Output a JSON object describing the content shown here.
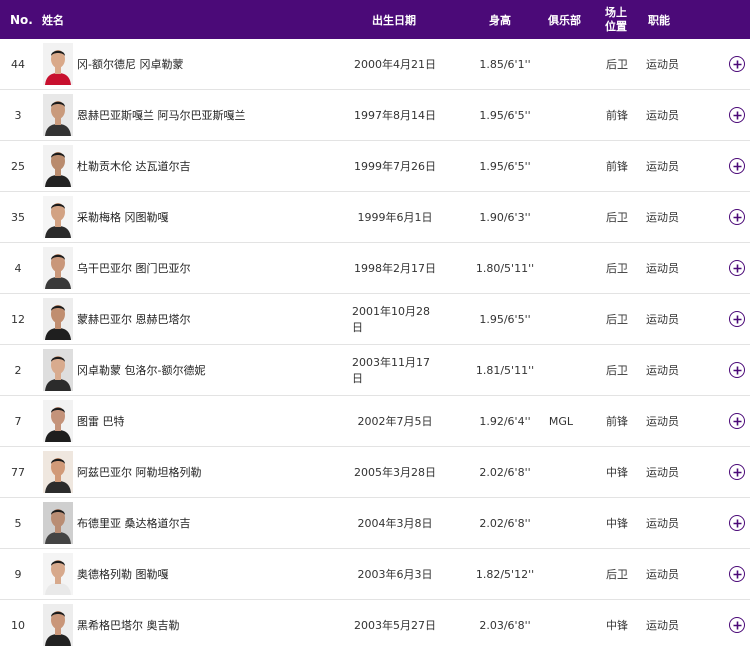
{
  "header": {
    "no": "No.",
    "name": "姓名",
    "dob": "出生日期",
    "height": "身高",
    "club": "俱乐部",
    "position": "场上位置",
    "role": "职能"
  },
  "colors": {
    "accent": "#4b0a78",
    "header_text": "#ffffff"
  },
  "icons": {
    "expand": "plus-circle-icon"
  },
  "players": [
    {
      "no": "44",
      "name": "冈-额尔德尼 冈卓勒蒙",
      "dob": "2000年4月21日",
      "height": "1.85/6'1''",
      "club": "",
      "position": "后卫",
      "role": "运动员",
      "shirt": "#c8102e",
      "skin": "#d9a98a",
      "bg": "#f2f2f2"
    },
    {
      "no": "3",
      "name": "恩赫巴亚斯嘎兰 阿马尔巴亚斯嘎兰",
      "dob": "1997年8月14日",
      "height": "1.95/6'5''",
      "club": "",
      "position": "前锋",
      "role": "运动员",
      "shirt": "#333333",
      "skin": "#c99a7c",
      "bg": "#e8e8e8"
    },
    {
      "no": "25",
      "name": "杜勒贡木伦 达瓦道尔吉",
      "dob": "1999年7月26日",
      "height": "1.95/6'5''",
      "club": "",
      "position": "前锋",
      "role": "运动员",
      "shirt": "#222222",
      "skin": "#b98b6d",
      "bg": "#f2f2f2"
    },
    {
      "no": "35",
      "name": "采勒梅格 冈图勒嘎",
      "dob": "1999年6月1日",
      "height": "1.90/6'3''",
      "club": "",
      "position": "后卫",
      "role": "运动员",
      "shirt": "#2a2a2a",
      "skin": "#d2a283",
      "bg": "#f5f5f5"
    },
    {
      "no": "4",
      "name": "乌干巴亚尔 图门巴亚尔",
      "dob": "1998年2月17日",
      "height": "1.80/5'11''",
      "club": "",
      "position": "后卫",
      "role": "运动员",
      "shirt": "#3a3a3a",
      "skin": "#c9977a",
      "bg": "#f2f2f2"
    },
    {
      "no": "12",
      "name": "蒙赫巴亚尔 恩赫巴塔尔",
      "dob": "2001年10月28日",
      "height": "1.95/6'5''",
      "club": "",
      "position": "后卫",
      "role": "运动员",
      "shirt": "#1f1f1f",
      "skin": "#c08e70",
      "bg": "#ededed"
    },
    {
      "no": "2",
      "name": "冈卓勒蒙 包洛尔-额尔德妮",
      "dob": "2003年11月17日",
      "height": "1.81/5'11''",
      "club": "",
      "position": "后卫",
      "role": "运动员",
      "shirt": "#2b2b2b",
      "skin": "#d8ab8e",
      "bg": "#dedede"
    },
    {
      "no": "7",
      "name": "图雷 巴特",
      "dob": "2002年7月5日",
      "height": "1.92/6'4''",
      "club": "MGL",
      "position": "前锋",
      "role": "运动员",
      "shirt": "#1e1e1e",
      "skin": "#c4937a",
      "bg": "#f2f2f2"
    },
    {
      "no": "77",
      "name": "阿兹巴亚尔 阿勒坦格列勒",
      "dob": "2005年3月28日",
      "height": "2.02/6'8''",
      "club": "",
      "position": "中锋",
      "role": "运动员",
      "shirt": "#2c2c2c",
      "skin": "#d19a78",
      "bg": "#efe7df"
    },
    {
      "no": "5",
      "name": "布德里亚 桑达格道尔吉",
      "dob": "2004年3月8日",
      "height": "2.02/6'8''",
      "club": "",
      "position": "中锋",
      "role": "运动员",
      "shirt": "#444444",
      "skin": "#b98d74",
      "bg": "#cfcfcf"
    },
    {
      "no": "9",
      "name": "奥德格列勒 图勒嘎",
      "dob": "2003年6月3日",
      "height": "1.82/5'12''",
      "club": "",
      "position": "后卫",
      "role": "运动员",
      "shirt": "#e9e9e9",
      "skin": "#d7a98c",
      "bg": "#f4f4f4"
    },
    {
      "no": "10",
      "name": "黑希格巴塔尔 奥吉勒",
      "dob": "2003年5月27日",
      "height": "2.03/6'8''",
      "club": "",
      "position": "中锋",
      "role": "运动员",
      "shirt": "#222222",
      "skin": "#c99679",
      "bg": "#ededed"
    }
  ]
}
